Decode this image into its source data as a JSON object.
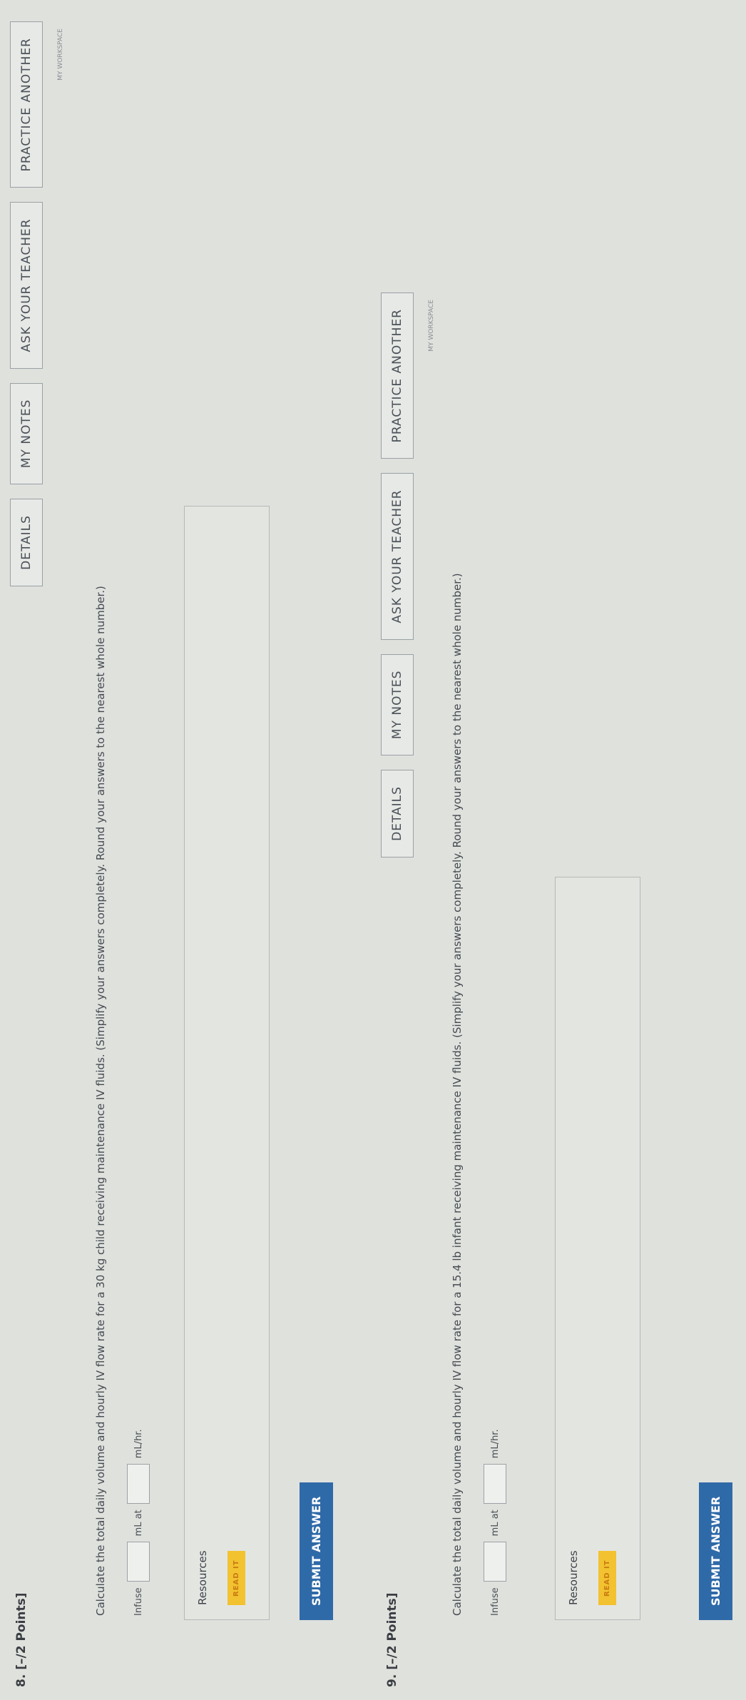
{
  "questions": [
    {
      "number_label": "8.",
      "points": "[–/2 Points]",
      "buttons": [
        "DETAILS",
        "MY NOTES",
        "ASK YOUR TEACHER",
        "PRACTICE ANOTHER"
      ],
      "workspace_note": "MY WORKSPACE",
      "prompt": "Calculate the total daily volume and hourly IV flow rate for a 30 kg child receiving maintenance IV fluids. (Simplify your answers completely. Round your answers to the nearest whole number.)",
      "answer_parts": [
        "Infuse",
        "mL at",
        "mL/hr."
      ],
      "resources_label": "Resources",
      "read_it": "READ IT",
      "submit": "SUBMIT ANSWER"
    },
    {
      "number_label": "9.",
      "points": "[–/2 Points]",
      "buttons": [
        "DETAILS",
        "MY NOTES",
        "ASK YOUR TEACHER",
        "PRACTICE ANOTHER"
      ],
      "workspace_note": "MY WORKSPACE",
      "prompt": "Calculate the total daily volume and hourly IV flow rate for a 15.4 lb infant receiving maintenance IV fluids. (Simplify your answers completely. Round your answers to the nearest whole number.)",
      "answer_parts": [
        "Infuse",
        "mL at",
        "mL/hr."
      ],
      "resources_label": "Resources",
      "read_it": "READ IT",
      "submit": "SUBMIT ANSWER"
    }
  ]
}
